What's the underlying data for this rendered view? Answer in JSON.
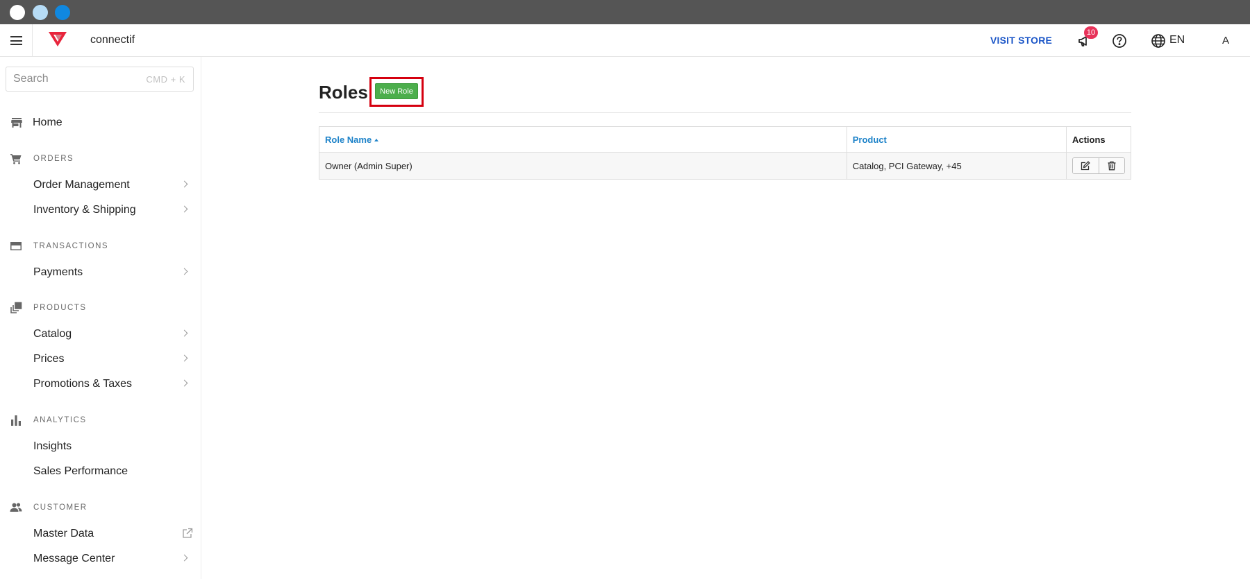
{
  "topbar": {
    "brand": "connectif",
    "visit_store": "VISIT STORE",
    "notification_count": "10",
    "language": "EN",
    "avatar_initial": "A",
    "accent_color": "#1a55c7",
    "logo_color": "#e8253c"
  },
  "sidebar": {
    "search_placeholder": "Search",
    "search_shortcut": "CMD + K",
    "home": "Home",
    "sections": {
      "orders": {
        "label": "ORDERS",
        "icon": "cart-icon",
        "items": [
          "Order Management",
          "Inventory & Shipping"
        ]
      },
      "transactions": {
        "label": "TRANSACTIONS",
        "icon": "card-icon",
        "items": [
          "Payments"
        ]
      },
      "products": {
        "label": "PRODUCTS",
        "icon": "products-icon",
        "items": [
          "Catalog",
          "Prices",
          "Promotions & Taxes"
        ]
      },
      "analytics": {
        "label": "ANALYTICS",
        "icon": "bar-chart-icon",
        "items": [
          "Insights",
          "Sales Performance"
        ]
      },
      "customer": {
        "label": "CUSTOMER",
        "icon": "people-icon",
        "items": [
          "Master Data",
          "Message Center"
        ]
      }
    }
  },
  "main": {
    "title": "Roles",
    "new_role_label": "New Role",
    "table": {
      "headers": {
        "role_name": "Role Name",
        "product": "Product",
        "actions": "Actions"
      },
      "rows": [
        {
          "role_name": "Owner (Admin Super)",
          "product": "Catalog, PCI Gateway, +45"
        }
      ]
    }
  }
}
